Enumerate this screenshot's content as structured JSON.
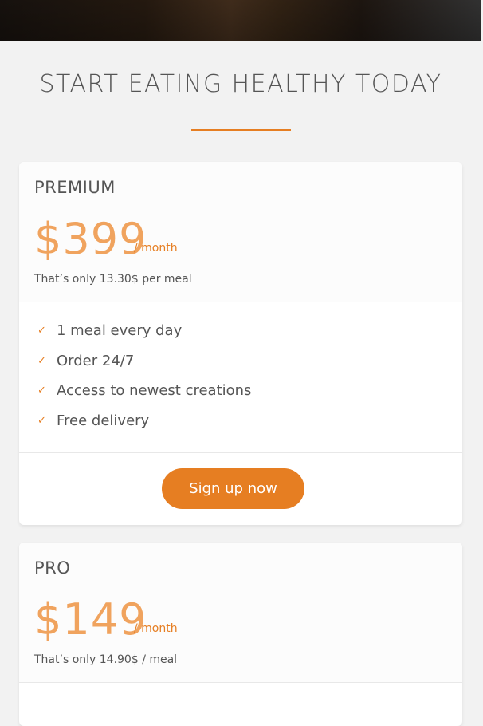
{
  "section": {
    "title": "START EATING HEALTHY TODAY"
  },
  "plans": [
    {
      "name": "PREMIUM",
      "price": "$399",
      "period": "/ month",
      "note": "That’s only 13.30$ per meal",
      "features": [
        "1 meal every day",
        "Order 24/7",
        "Access to newest creations",
        "Free delivery"
      ],
      "cta": "Sign up now"
    },
    {
      "name": "PRO",
      "price": "$149",
      "period": "/ month",
      "note": "That’s only 14.90$ / meal"
    }
  ],
  "colors": {
    "accent": "#e67e22",
    "price": "#f0a35e",
    "background": "#f2f2f2",
    "card": "#ffffff"
  },
  "icons": {
    "feature_check": "checkmark-icon"
  }
}
